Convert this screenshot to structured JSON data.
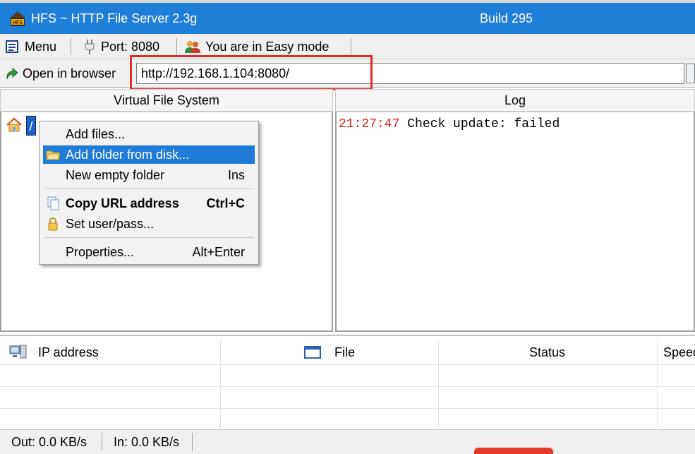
{
  "window": {
    "title": "HFS ~ HTTP File Server 2.3g",
    "build": "Build 295",
    "logo_text": "HFS",
    "accent_color": "#1f7fd6"
  },
  "toolbar": {
    "menu_label": "Menu",
    "menu_icon": "menu-list-icon",
    "port_label": "Port: 8080",
    "port_icon": "plug-icon",
    "mode_label": "You are in Easy mode",
    "mode_icon": "users-icon"
  },
  "address_bar": {
    "open_label": "Open in browser",
    "open_icon": "green-arrow-icon",
    "url": "http://192.168.1.104:8080/",
    "highlight_color": "#e12b2b"
  },
  "vfs": {
    "header": "Virtual File System",
    "root_label": "/",
    "root_icon": "home-icon"
  },
  "log": {
    "header": "Log",
    "entries": [
      {
        "time": "21:27:47",
        "message": "Check update: failed",
        "time_color": "#e02020"
      }
    ]
  },
  "context_menu": {
    "items": [
      {
        "label": "Add files...",
        "shortcut": "",
        "icon": ""
      },
      {
        "label": "Add folder from disk...",
        "shortcut": "",
        "icon": "folder-icon",
        "selected": true
      },
      {
        "label": "New empty folder",
        "shortcut": "Ins",
        "icon": ""
      },
      {
        "label": "Copy URL address",
        "shortcut": "Ctrl+C",
        "icon": "copy-icon",
        "bold": true
      },
      {
        "label": "Set user/pass...",
        "shortcut": "",
        "icon": "lock-icon"
      },
      {
        "label": "Properties...",
        "shortcut": "Alt+Enter",
        "icon": ""
      }
    ]
  },
  "connections": {
    "columns": [
      "IP address",
      "File",
      "Status",
      "Speed"
    ],
    "column_icons": [
      "network-computer-icon",
      "window-icon",
      "",
      ""
    ],
    "rows": []
  },
  "status_bar": {
    "out": "Out: 0.0 KB/s",
    "in": "In: 0.0 KB/s"
  }
}
